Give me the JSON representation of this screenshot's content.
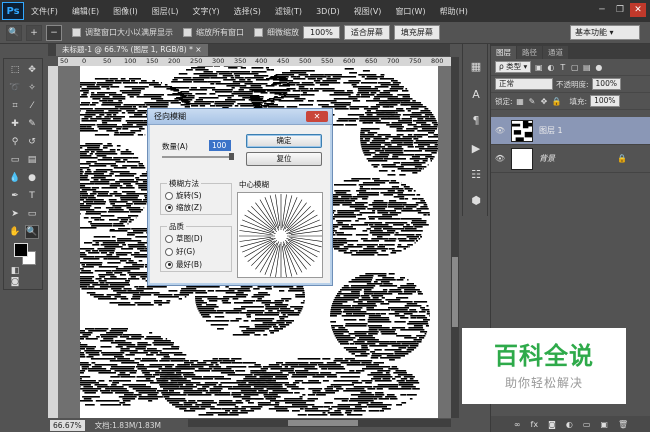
{
  "app": {
    "logo": "Ps"
  },
  "menu": [
    "文件(F)",
    "编辑(E)",
    "图像(I)",
    "图层(L)",
    "文字(Y)",
    "选择(S)",
    "滤镜(T)",
    "3D(D)",
    "视图(V)",
    "窗口(W)",
    "帮助(H)"
  ],
  "window_controls": {
    "minimize": "─",
    "restore": "❐",
    "close": "✕"
  },
  "options_bar": {
    "tool_icon": "zoom-icon",
    "resize_windows": "调整窗口大小以满屏显示",
    "zoom_all": "缩放所有窗口",
    "scrubby_zoom": "细微缩放",
    "btn_100": "100%",
    "btn_fit": "适合屏幕",
    "btn_fill": "填充屏幕",
    "workspace": "基本功能"
  },
  "document": {
    "tab_title": "未标题-1 @ 66.7% (图层 1, RGB/8) *",
    "tab_close": "×",
    "ruler_ticks": [
      "50",
      "0",
      "50",
      "100",
      "150",
      "200",
      "250",
      "300",
      "350",
      "400",
      "450",
      "500",
      "550",
      "600",
      "650",
      "700",
      "750",
      "800"
    ]
  },
  "status": {
    "zoom": "66.67%",
    "doc_info": "文档:1.83M/1.83M"
  },
  "dialog": {
    "title": "径向模糊",
    "close": "✕",
    "amount_label": "数量(A)",
    "amount_value": "100",
    "amount": 100,
    "amount_max": 100,
    "ok": "确定",
    "reset": "复位",
    "method_legend": "模糊方法",
    "methods": [
      {
        "label": "旋转(S)",
        "selected": false
      },
      {
        "label": "缩放(Z)",
        "selected": true
      }
    ],
    "quality_legend": "品质",
    "qualities": [
      {
        "label": "草图(D)",
        "selected": false
      },
      {
        "label": "好(G)",
        "selected": false
      },
      {
        "label": "最好(B)",
        "selected": true
      }
    ],
    "center_label": "中心模糊"
  },
  "panel": {
    "tabs": [
      "图层",
      "路径",
      "通道"
    ],
    "active_tab": 0,
    "filter_kind": "ρ 类型",
    "blend_mode": "正常",
    "opacity_label": "不透明度:",
    "opacity": "100%",
    "lock_label": "锁定:",
    "fill_label": "填充:",
    "fill": "100%",
    "layers": [
      {
        "name": "图层 1",
        "visible": true,
        "selected": true,
        "locked": false
      },
      {
        "name": "背景",
        "visible": true,
        "selected": false,
        "locked": true
      }
    ]
  },
  "watermark": {
    "title": "百科全说",
    "subtitle": "助你轻松解决"
  },
  "colors": {
    "accent": "#31a8ff",
    "selected_layer": "#8a97b6",
    "watermark_green": "#2eaa4a"
  }
}
